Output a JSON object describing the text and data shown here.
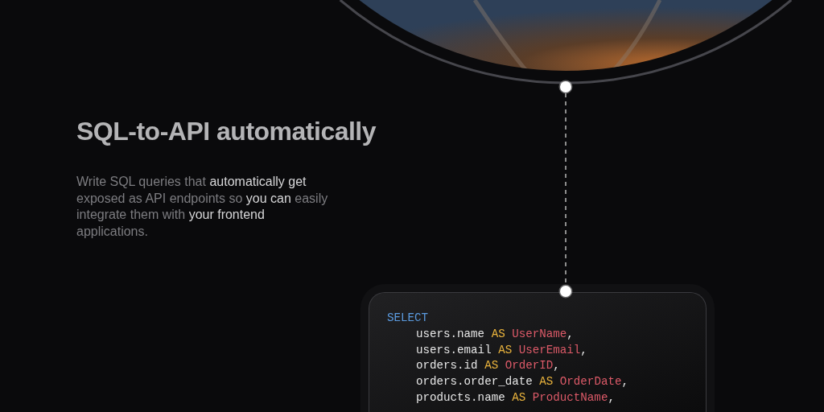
{
  "heading": "SQL-to-API automatically",
  "description": "Write SQL queries that **automatically get** exposed as API endpoints so **you can** easily integrate them with **your frontend** applications.",
  "code_lines": [
    {
      "indented": false,
      "tokens": [
        {
          "kind": "keyword",
          "text": "SELECT"
        }
      ]
    },
    {
      "indented": true,
      "tokens": [
        {
          "kind": "plain",
          "text": "users.name"
        },
        {
          "kind": "as",
          "text": "AS"
        },
        {
          "kind": "alias",
          "text": "UserName"
        },
        {
          "kind": "punct",
          "text": ","
        }
      ]
    },
    {
      "indented": true,
      "tokens": [
        {
          "kind": "plain",
          "text": "users.email"
        },
        {
          "kind": "as",
          "text": "AS"
        },
        {
          "kind": "alias",
          "text": "UserEmail"
        },
        {
          "kind": "punct",
          "text": ","
        }
      ]
    },
    {
      "indented": true,
      "tokens": [
        {
          "kind": "plain",
          "text": "orders.id"
        },
        {
          "kind": "as",
          "text": "AS"
        },
        {
          "kind": "alias",
          "text": "OrderID"
        },
        {
          "kind": "punct",
          "text": ","
        }
      ]
    },
    {
      "indented": true,
      "tokens": [
        {
          "kind": "plain",
          "text": "orders.order_date"
        },
        {
          "kind": "as",
          "text": "AS"
        },
        {
          "kind": "alias",
          "text": "OrderDate"
        },
        {
          "kind": "punct",
          "text": ","
        }
      ]
    },
    {
      "indented": true,
      "tokens": [
        {
          "kind": "plain",
          "text": "products.name"
        },
        {
          "kind": "as",
          "text": "AS"
        },
        {
          "kind": "alias",
          "text": "ProductName"
        },
        {
          "kind": "punct",
          "text": ","
        }
      ]
    }
  ]
}
